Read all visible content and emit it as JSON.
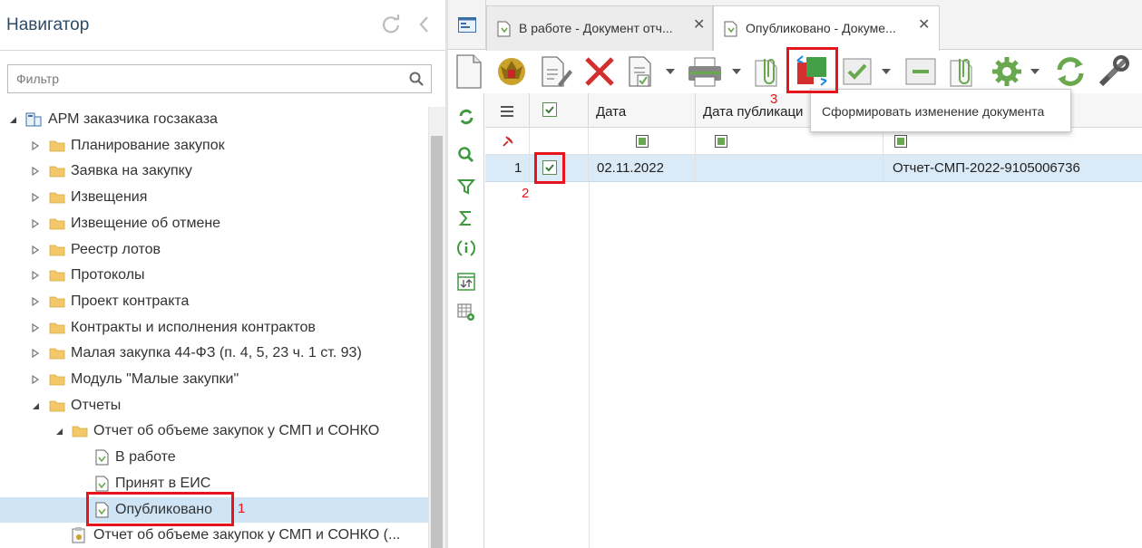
{
  "navigator": {
    "title": "Навигатор",
    "filter_placeholder": "Фильтр",
    "tree": [
      {
        "label": "АРМ заказчика госзаказа",
        "level": 0,
        "expanded": true,
        "icon": "workstation-icon"
      },
      {
        "label": "Планирование закупок",
        "level": 1,
        "expanded": false,
        "icon": "folder-icon"
      },
      {
        "label": "Заявка на закупку",
        "level": 1,
        "expanded": false,
        "icon": "folder-icon"
      },
      {
        "label": "Извещения",
        "level": 1,
        "expanded": false,
        "icon": "folder-icon"
      },
      {
        "label": "Извещение об отмене",
        "level": 1,
        "expanded": false,
        "icon": "folder-icon"
      },
      {
        "label": "Реестр лотов",
        "level": 1,
        "expanded": false,
        "icon": "folder-icon"
      },
      {
        "label": "Протоколы",
        "level": 1,
        "expanded": false,
        "icon": "folder-icon"
      },
      {
        "label": "Проект контракта",
        "level": 1,
        "expanded": false,
        "icon": "folder-icon"
      },
      {
        "label": "Контракты и исполнения контрактов",
        "level": 1,
        "expanded": false,
        "icon": "folder-icon"
      },
      {
        "label": "Малая закупка 44-ФЗ (п. 4, 5, 23 ч. 1 ст. 93)",
        "level": 1,
        "expanded": false,
        "icon": "folder-icon"
      },
      {
        "label": "Модуль \"Малые закупки\"",
        "level": 1,
        "expanded": false,
        "icon": "folder-icon"
      },
      {
        "label": "Отчеты",
        "level": 1,
        "expanded": true,
        "icon": "folder-icon"
      },
      {
        "label": "Отчет об объеме закупок у СМП и СОНКО",
        "level": 2,
        "expanded": true,
        "icon": "folder-icon"
      },
      {
        "label": "В работе",
        "level": 3,
        "icon": "document-state-icon"
      },
      {
        "label": "Принят в ЕИС",
        "level": 3,
        "icon": "document-state-icon"
      },
      {
        "label": "Опубликовано",
        "level": 3,
        "icon": "document-state-icon",
        "selected": true
      },
      {
        "label": "Отчет об объеме закупок у СМП и СОНКО (...",
        "level": 2,
        "icon": "report-icon"
      }
    ]
  },
  "tabs": [
    {
      "label": "В работе - Документ отч...",
      "close": "✕",
      "active": false
    },
    {
      "label": "Опубликовано - Докуме...",
      "close": "✕",
      "active": true
    }
  ],
  "tooltip": "Сформировать изменение документа",
  "grid": {
    "columns": [
      "Дата",
      "Дата публикаци"
    ],
    "rows": [
      {
        "num": "1",
        "checked": true,
        "date": "02.11.2022",
        "pub_date": "",
        "name": "Отчет-СМП-2022-9105006736"
      }
    ]
  },
  "annotations": [
    "1",
    "2",
    "3"
  ],
  "colors": {
    "accent": "#2d4a67",
    "selection": "#cfe5f5",
    "row_selected": "#dbeaf7",
    "highlight": "#e8141b",
    "green": "#6aa84f"
  }
}
